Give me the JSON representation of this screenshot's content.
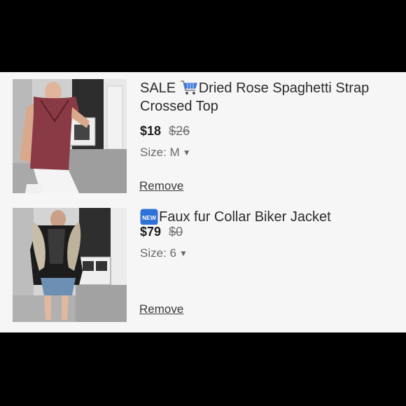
{
  "cart": {
    "items": [
      {
        "badge_text": "SALE",
        "icon": "shopping-cart-emoji",
        "title": "Dried Rose Spaghetti Strap Crossed Top",
        "price": "$18",
        "original_price": "$26",
        "size_label": "Size: M",
        "remove_label": "Remove",
        "thumbnail": "photo of woman in rose-colored strappy top in closet"
      },
      {
        "badge_icon": "new-button-emoji",
        "badge_icon_text": "NEW",
        "title": "Faux fur Collar Biker Jacket",
        "price": "$79",
        "original_price": "$0",
        "size_label": "Size: 6",
        "remove_label": "Remove",
        "thumbnail": "photo of woman in faux fur collar jacket in closet"
      }
    ]
  },
  "colors": {
    "panel_bg": "#f7f6f6",
    "frame": "#000000",
    "cart_blue": "#2f6bd8",
    "new_blue": "#2f72d6"
  }
}
